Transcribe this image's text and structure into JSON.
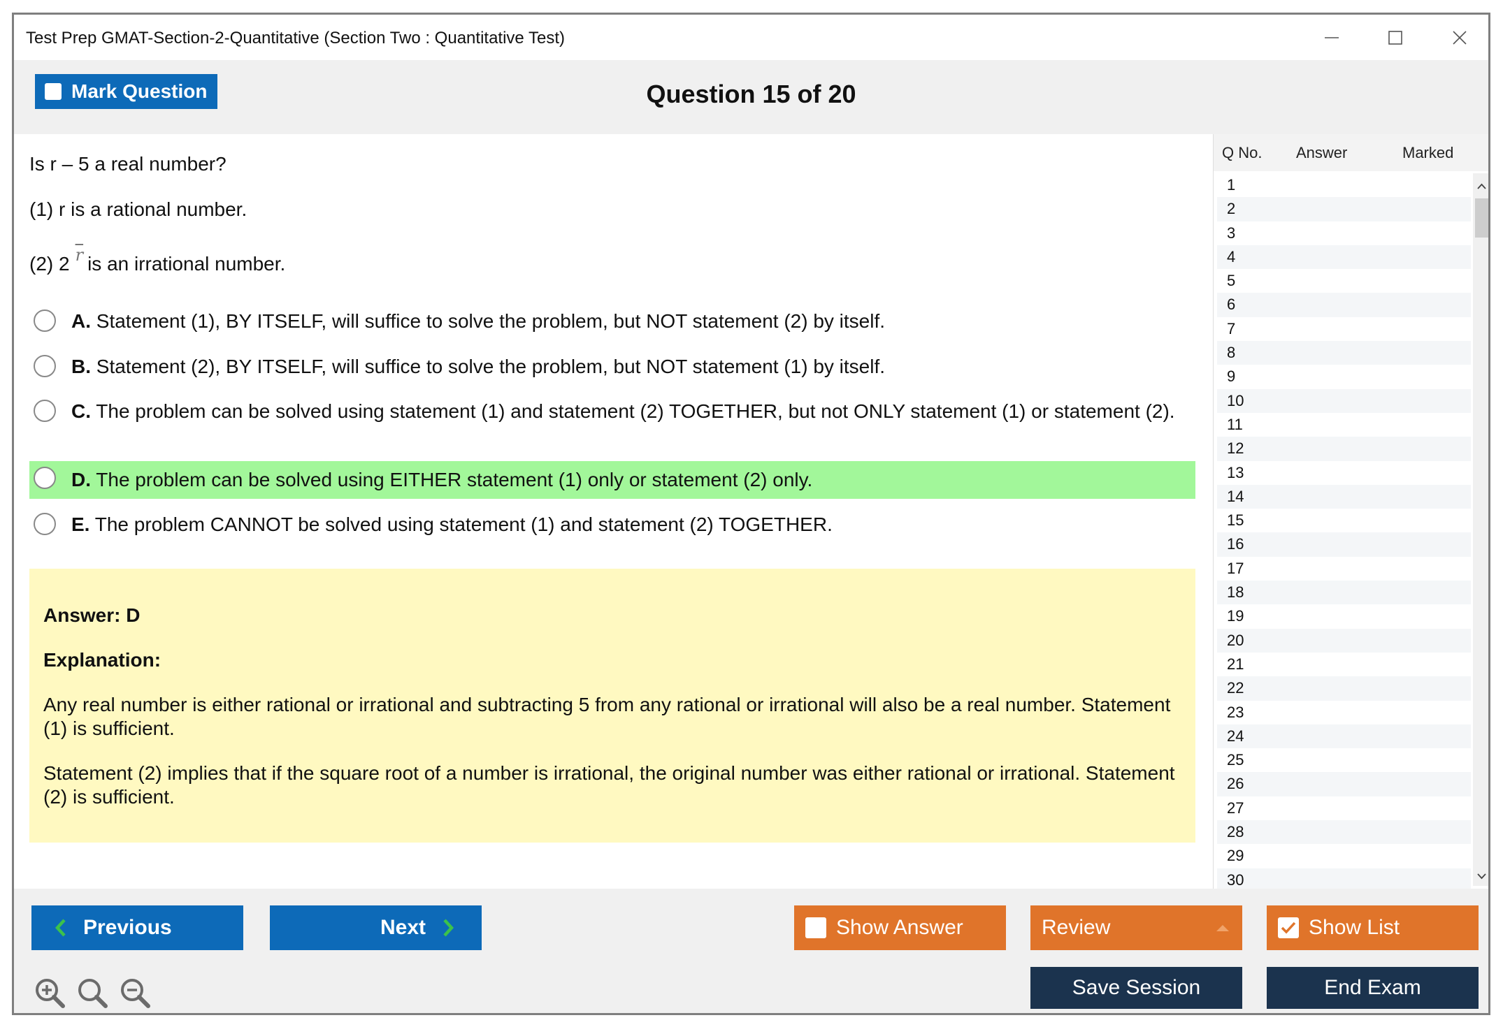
{
  "window": {
    "title": "Test Prep GMAT-Section-2-Quantitative (Section Two : Quantitative Test)"
  },
  "toolbar": {
    "mark_label": "Mark Question",
    "question_title": "Question 15 of 20"
  },
  "question": {
    "stem": "Is r – 5 a real number?",
    "statement1": "(1) r is a rational number.",
    "statement2_prefix": "(2) 2",
    "statement2_symbol": "r",
    "statement2_suffix": "is an irrational number."
  },
  "options": [
    {
      "letter": "A.",
      "text": " Statement (1), BY ITSELF, will suffice to solve the problem, but NOT statement (2) by itself.",
      "highlighted": false
    },
    {
      "letter": "B.",
      "text": " Statement (2), BY ITSELF, will suffice to solve the problem, but NOT statement (1) by itself.",
      "highlighted": false
    },
    {
      "letter": "C.",
      "text": " The problem can be solved using statement (1) and statement (2) TOGETHER, but not ONLY statement (1) or statement (2).",
      "highlighted": false
    },
    {
      "letter": "D.",
      "text": " The problem can be solved using EITHER statement (1) only or statement (2) only.",
      "highlighted": true
    },
    {
      "letter": "E.",
      "text": " The problem CANNOT be solved using statement (1) and statement (2) TOGETHER.",
      "highlighted": false
    }
  ],
  "answer": {
    "answer_line": "Answer: D",
    "explanation_heading": "Explanation:",
    "para1": "Any real number is either rational or irrational and subtracting 5 from any rational or irrational will also be a real number. Statement (1) is sufficient.",
    "para2": "Statement (2) implies that if the square root of a number is irrational, the original number was either rational or irrational. Statement (2) is sufficient."
  },
  "question_list": {
    "headers": {
      "qno": "Q No.",
      "answer": "Answer",
      "marked": "Marked"
    },
    "rows": [
      "1",
      "2",
      "3",
      "4",
      "5",
      "6",
      "7",
      "8",
      "9",
      "10",
      "11",
      "12",
      "13",
      "14",
      "15",
      "16",
      "17",
      "18",
      "19",
      "20",
      "21",
      "22",
      "23",
      "24",
      "25",
      "26",
      "27",
      "28",
      "29",
      "30"
    ]
  },
  "bottom": {
    "previous_label": "Previous",
    "next_label": "Next",
    "show_answer_label": "Show Answer",
    "review_label": "Review",
    "show_list_label": "Show List",
    "save_session_label": "Save Session",
    "end_exam_label": "End Exam"
  },
  "colors": {
    "primary_blue": "#0d6ab8",
    "orange": "#e0742a",
    "navy": "#1b334e",
    "highlight_green": "#a2f79a",
    "answer_yellow": "#fff9c1",
    "arrow_green": "#3cc24b"
  },
  "icons": [
    "minimize-icon",
    "maximize-icon",
    "close-icon",
    "chevron-left-icon",
    "chevron-right-icon",
    "caret-up-icon",
    "checkbox-icon",
    "zoom-in-icon",
    "zoom-reset-icon",
    "zoom-out-icon",
    "scroll-up-icon",
    "scroll-down-icon"
  ]
}
